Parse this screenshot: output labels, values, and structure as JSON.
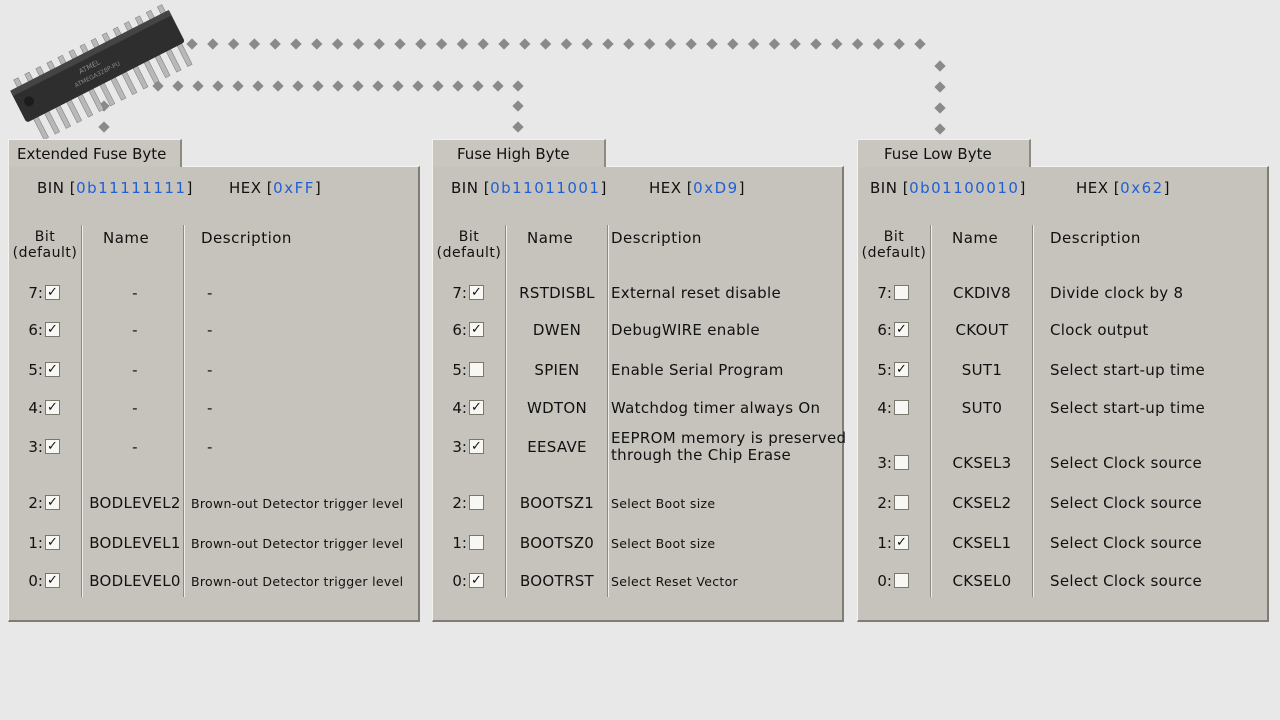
{
  "bytes": [
    {
      "tab": "Extended Fuse Byte",
      "bin_label": "BIN [",
      "bin_value": "0b11111111",
      "bin_close": "]",
      "hex_label": "HEX [",
      "hex_value": "0xFF",
      "hex_close": "]",
      "col_bit": "Bit\n(default)",
      "col_name": "Name",
      "col_desc": "Description",
      "rows": [
        {
          "bit": "7:",
          "checked": true,
          "name": "-",
          "desc": "-"
        },
        {
          "bit": "6:",
          "checked": true,
          "name": "-",
          "desc": "-"
        },
        {
          "bit": "5:",
          "checked": true,
          "name": "-",
          "desc": "-"
        },
        {
          "bit": "4:",
          "checked": true,
          "name": "-",
          "desc": "-"
        },
        {
          "bit": "3:",
          "checked": true,
          "name": "-",
          "desc": "-"
        },
        {
          "bit": "2:",
          "checked": true,
          "name": "BODLEVEL2",
          "desc": "Brown-out Detector trigger level"
        },
        {
          "bit": "1:",
          "checked": true,
          "name": "BODLEVEL1",
          "desc": "Brown-out Detector trigger level"
        },
        {
          "bit": "0:",
          "checked": true,
          "name": "BODLEVEL0",
          "desc": "Brown-out Detector trigger level"
        }
      ]
    },
    {
      "tab": "Fuse High Byte",
      "bin_label": "BIN [",
      "bin_value": "0b11011001",
      "bin_close": "]",
      "hex_label": "HEX [",
      "hex_value": "0xD9",
      "hex_close": "]",
      "col_bit": "Bit\n(default)",
      "col_name": "Name",
      "col_desc": "Description",
      "rows": [
        {
          "bit": "7:",
          "checked": true,
          "name": "RSTDISBL",
          "desc": "External reset disable"
        },
        {
          "bit": "6:",
          "checked": true,
          "name": "DWEN",
          "desc": "DebugWIRE enable"
        },
        {
          "bit": "5:",
          "checked": false,
          "name": "SPIEN",
          "desc": "Enable Serial Program"
        },
        {
          "bit": "4:",
          "checked": true,
          "name": "WDTON",
          "desc": "Watchdog timer always On"
        },
        {
          "bit": "3:",
          "checked": true,
          "name": "EESAVE",
          "desc": "EEPROM memory is preserved through the Chip Erase"
        },
        {
          "bit": "2:",
          "checked": false,
          "name": "BOOTSZ1",
          "desc": "Select Boot size"
        },
        {
          "bit": "1:",
          "checked": false,
          "name": "BOOTSZ0",
          "desc": "Select Boot size"
        },
        {
          "bit": "0:",
          "checked": true,
          "name": "BOOTRST",
          "desc": "Select Reset Vector"
        }
      ]
    },
    {
      "tab": "Fuse Low Byte",
      "bin_label": "BIN [",
      "bin_value": "0b01100010",
      "bin_close": "]",
      "hex_label": "HEX [",
      "hex_value": "0x62",
      "hex_close": "]",
      "col_bit": "Bit\n(default)",
      "col_name": "Name",
      "col_desc": "Description",
      "rows": [
        {
          "bit": "7:",
          "checked": false,
          "name": "CKDIV8",
          "desc": "Divide clock by 8"
        },
        {
          "bit": "6:",
          "checked": true,
          "name": "CKOUT",
          "desc": "Clock output"
        },
        {
          "bit": "5:",
          "checked": true,
          "name": "SUT1",
          "desc": "Select start-up time"
        },
        {
          "bit": "4:",
          "checked": false,
          "name": "SUT0",
          "desc": "Select start-up time"
        },
        {
          "bit": "3:",
          "checked": false,
          "name": "CKSEL3",
          "desc": "Select Clock source"
        },
        {
          "bit": "2:",
          "checked": false,
          "name": "CKSEL2",
          "desc": "Select Clock source"
        },
        {
          "bit": "1:",
          "checked": true,
          "name": "CKSEL1",
          "desc": "Select Clock source"
        },
        {
          "bit": "0:",
          "checked": false,
          "name": "CKSEL0",
          "desc": "Select Clock source"
        }
      ]
    }
  ],
  "colors": {
    "accent": "#1f5fd6",
    "panel": "#c6c3bc",
    "background": "#e8e8e8",
    "wire": "#8a8a8a"
  },
  "icons": {
    "chip": "microcontroller-chip-icon",
    "check": "✓"
  }
}
